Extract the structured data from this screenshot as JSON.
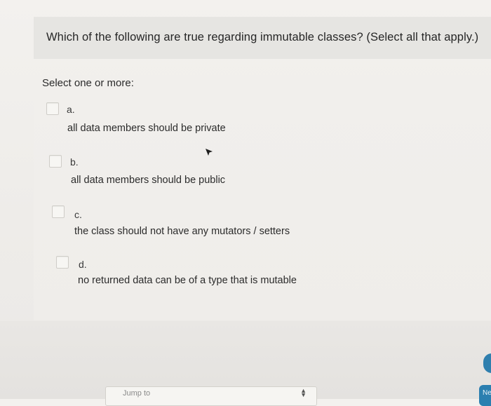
{
  "question": {
    "text": "Which of the following are true regarding immutable classes? (Select all that apply.)"
  },
  "prompt": {
    "select_label": "Select one or more:"
  },
  "options": [
    {
      "letter": "a.",
      "text": "all data members should be private",
      "checked": false
    },
    {
      "letter": "b.",
      "text": "all data members should be public",
      "checked": false
    },
    {
      "letter": "c.",
      "text": "the class should not have any mutators / setters",
      "checked": false
    },
    {
      "letter": "d.",
      "text": "no returned data can be of a type that is mutable",
      "checked": false
    }
  ],
  "footer": {
    "jump_label": "Jump to",
    "next_label": "Ne"
  },
  "icons": {
    "cursor": "pointer-cursor-icon",
    "select_arrows": "updown-arrows-icon"
  },
  "colors": {
    "accent": "#2b7fb0",
    "background": "#efedea"
  }
}
